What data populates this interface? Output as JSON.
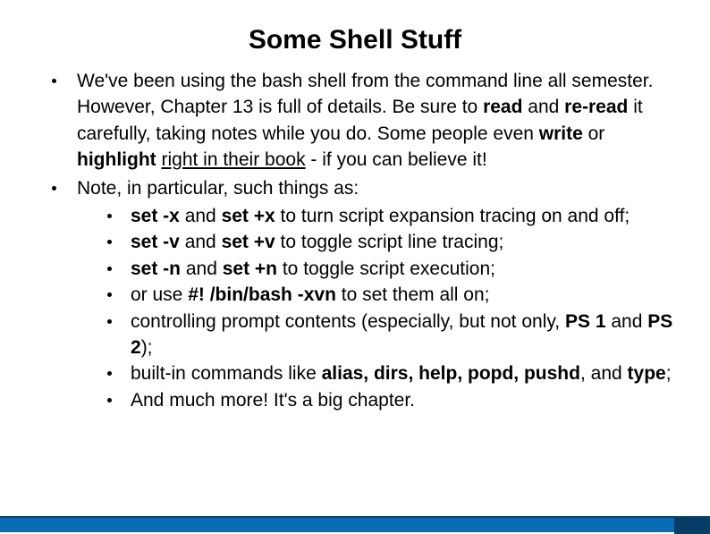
{
  "title": "Some Shell Stuff",
  "p1": {
    "t1": "We've been using the bash shell from the command line all semester. However, Chapter 13 is full of details. Be sure to ",
    "b1": "read",
    "t2": " and ",
    "b2": "re-read",
    "t3": " it carefully, taking notes while you do. Some people even ",
    "b3": "write",
    "t4": " or ",
    "b4": "highlight",
    "t5": " ",
    "u1": "right in their book",
    "t6": " - if you can believe it!"
  },
  "p2": "Note, in particular, such things as:",
  "sub": {
    "i1": {
      "b1": "set -x",
      "t1": " and ",
      "b2": "set +x",
      "t2": " to turn script expansion tracing on and off;"
    },
    "i2": {
      "b1": "set -v",
      "t1": " and ",
      "b2": "set +v",
      "t2": " to toggle script line tracing;"
    },
    "i3": {
      "b1": "set -n",
      "t1": " and ",
      "b2": "set +n",
      "t2": " to toggle script execution;"
    },
    "i4": {
      "t1": "or use ",
      "b1": "#! /bin/bash -xvn",
      "t2": " to set them all on;"
    },
    "i5": {
      "t1": "controlling prompt contents (especially, but not only, ",
      "b1": "PS 1",
      "t2": " and ",
      "b2": "PS 2",
      "t3": ");"
    },
    "i6": {
      "t1": "built-in commands like ",
      "b1": "alias, dirs, help, popd, pushd",
      "t2": ", and ",
      "b2": "type",
      "t3": ";"
    },
    "i7": "And much more! It's a big chapter."
  }
}
